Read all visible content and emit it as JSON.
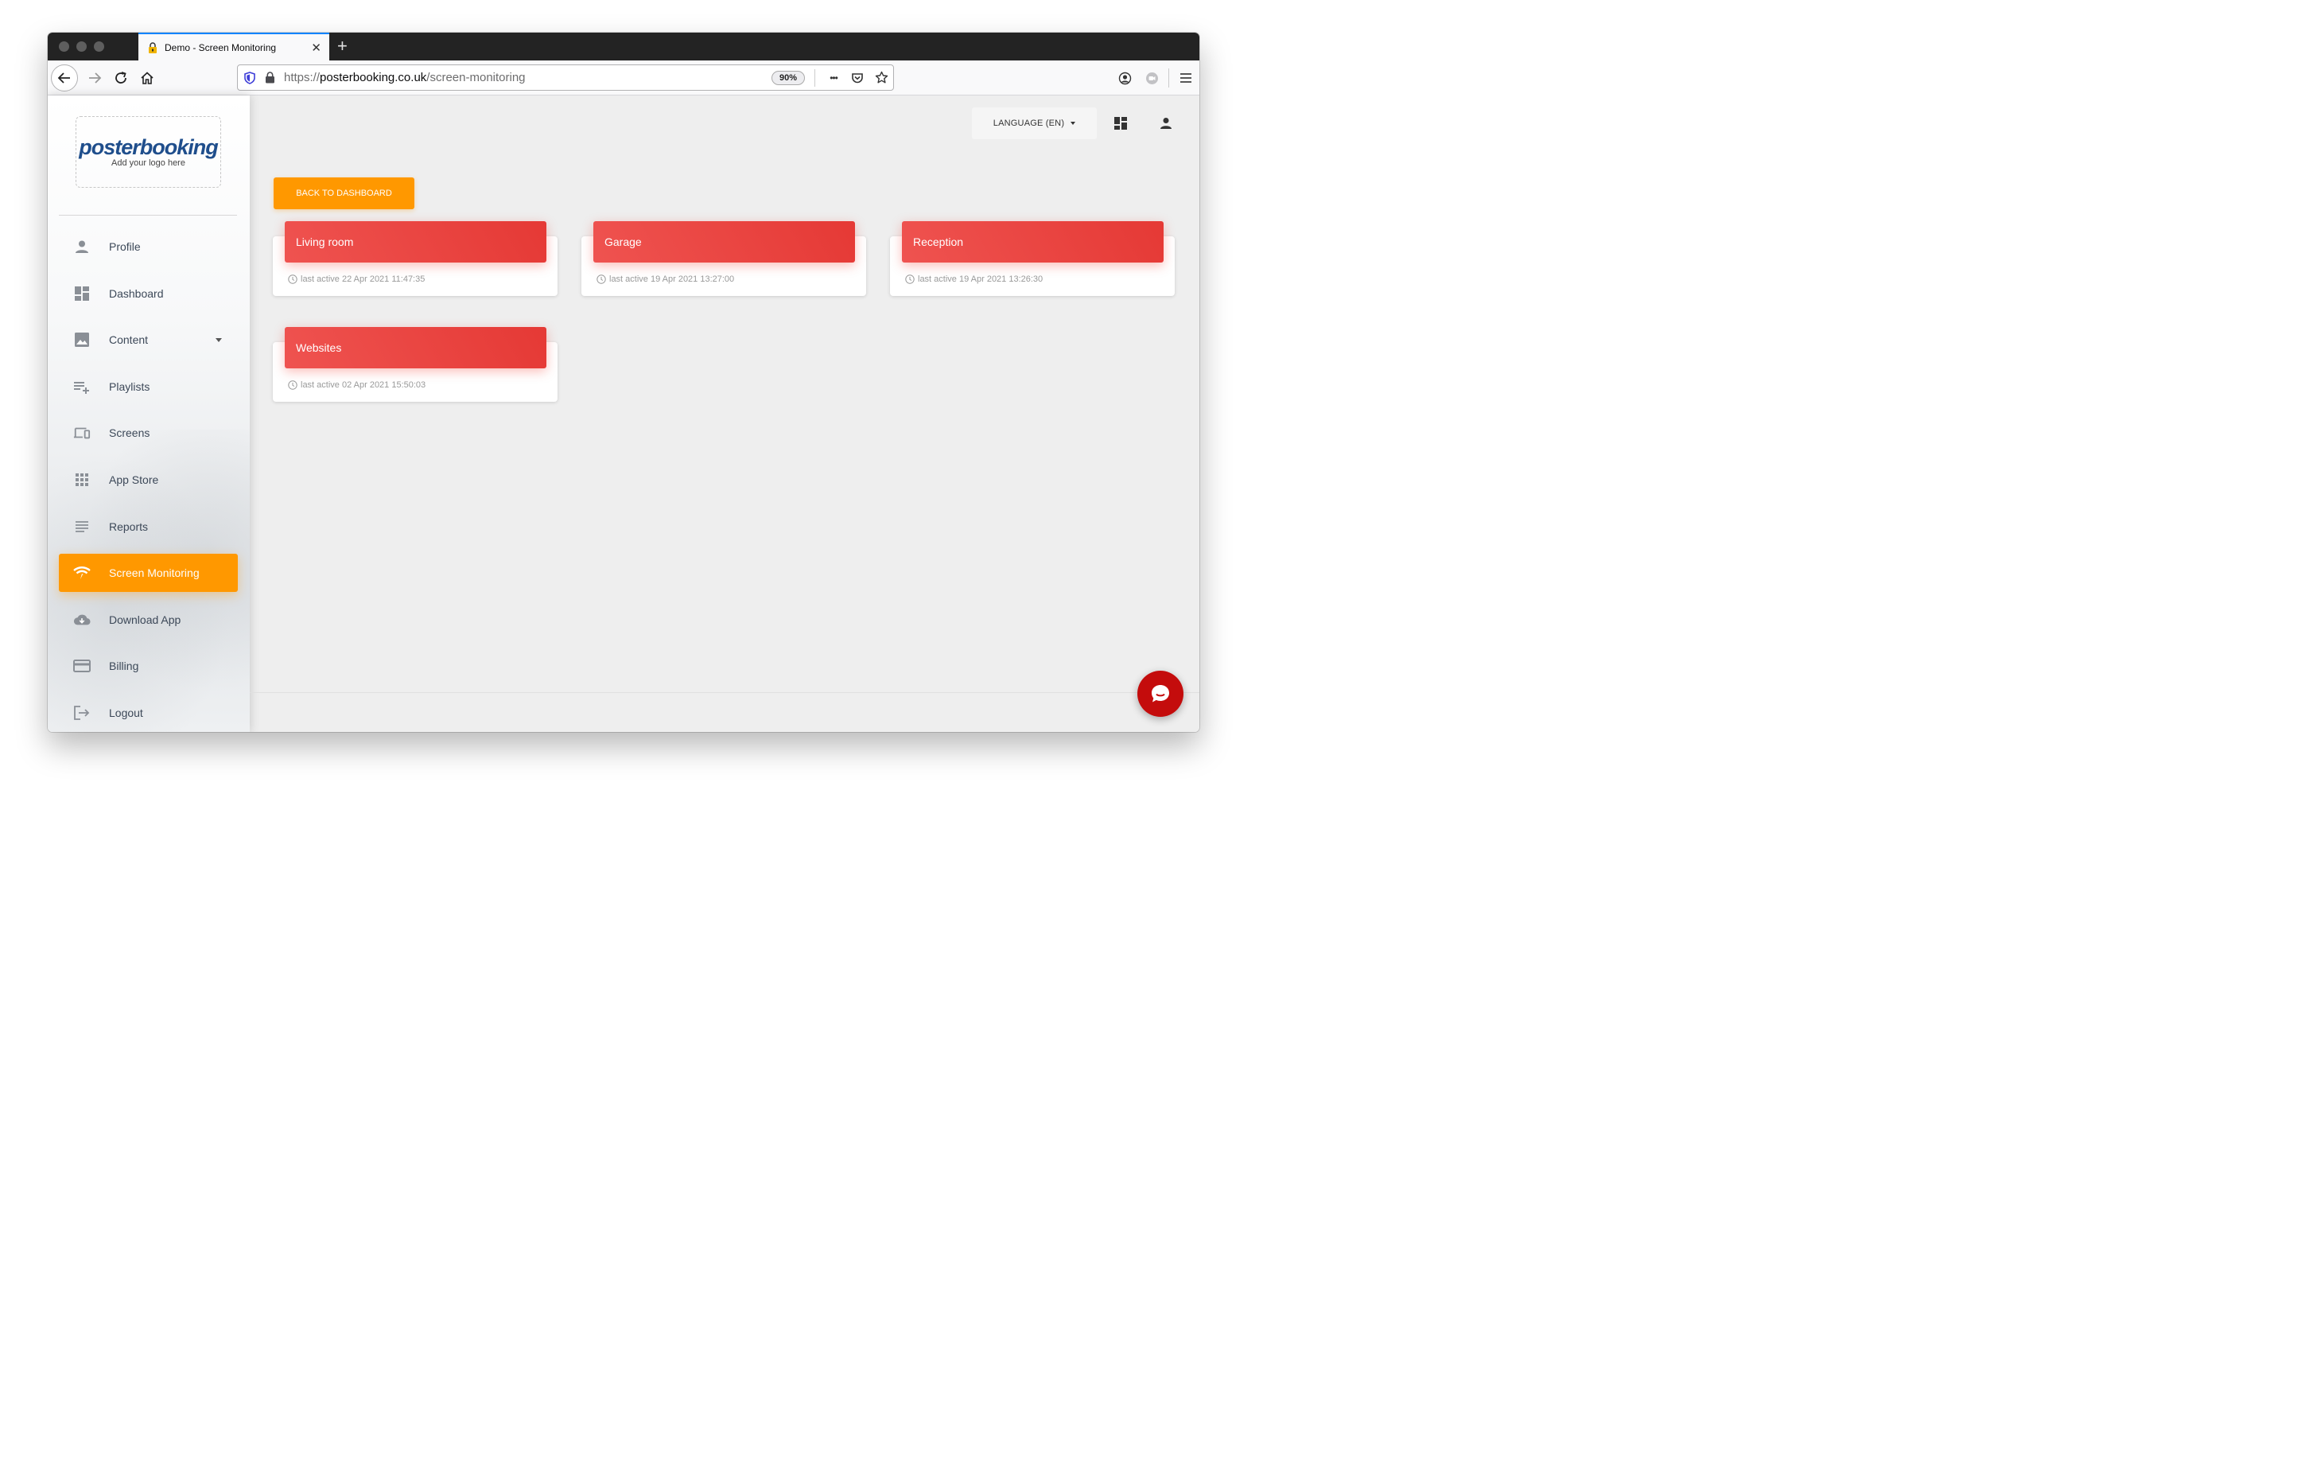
{
  "browser": {
    "tab_title": "Demo - Screen Monitoring",
    "tab_close": "✕",
    "new_tab": "+",
    "url_prefix": "https://",
    "url_domain": "posterbooking.co.uk",
    "url_path": "/screen-monitoring",
    "zoom": "90%",
    "more_dots": "•••"
  },
  "sidebar": {
    "logo_text": "posterbooking",
    "logo_sub": "Add your logo here",
    "items": [
      {
        "label": "Profile",
        "icon": "person-icon"
      },
      {
        "label": "Dashboard",
        "icon": "dashboard-icon"
      },
      {
        "label": "Content",
        "icon": "image-icon"
      },
      {
        "label": "Playlists",
        "icon": "playlist-add-icon"
      },
      {
        "label": "Screens",
        "icon": "devices-icon"
      },
      {
        "label": "App Store",
        "icon": "apps-grid-icon"
      },
      {
        "label": "Reports",
        "icon": "reports-lines-icon"
      },
      {
        "label": "Screen Monitoring",
        "icon": "wifi-signal-icon"
      },
      {
        "label": "Download App",
        "icon": "cloud-download-icon"
      },
      {
        "label": "Billing",
        "icon": "credit-card-icon"
      },
      {
        "label": "Logout",
        "icon": "logout-icon"
      }
    ],
    "active_item": "Screen Monitoring"
  },
  "header": {
    "language_button": "LANGUAGE (EN)"
  },
  "main": {
    "back_button": "BACK TO DASHBOARD",
    "screens": [
      {
        "name": "Living room",
        "status": "last active 22 Apr 2021 11:47:35"
      },
      {
        "name": "Garage",
        "status": "last active 19 Apr 2021 13:27:00"
      },
      {
        "name": "Reception",
        "status": "last active 19 Apr 2021 13:26:30"
      },
      {
        "name": "Websites",
        "status": "last active 02 Apr 2021 15:50:03"
      }
    ]
  },
  "colors": {
    "accent_orange": "#ff9800",
    "card_red": "#e53935",
    "logo_blue": "#1f4e8c",
    "chat_red": "#c40c0c"
  }
}
